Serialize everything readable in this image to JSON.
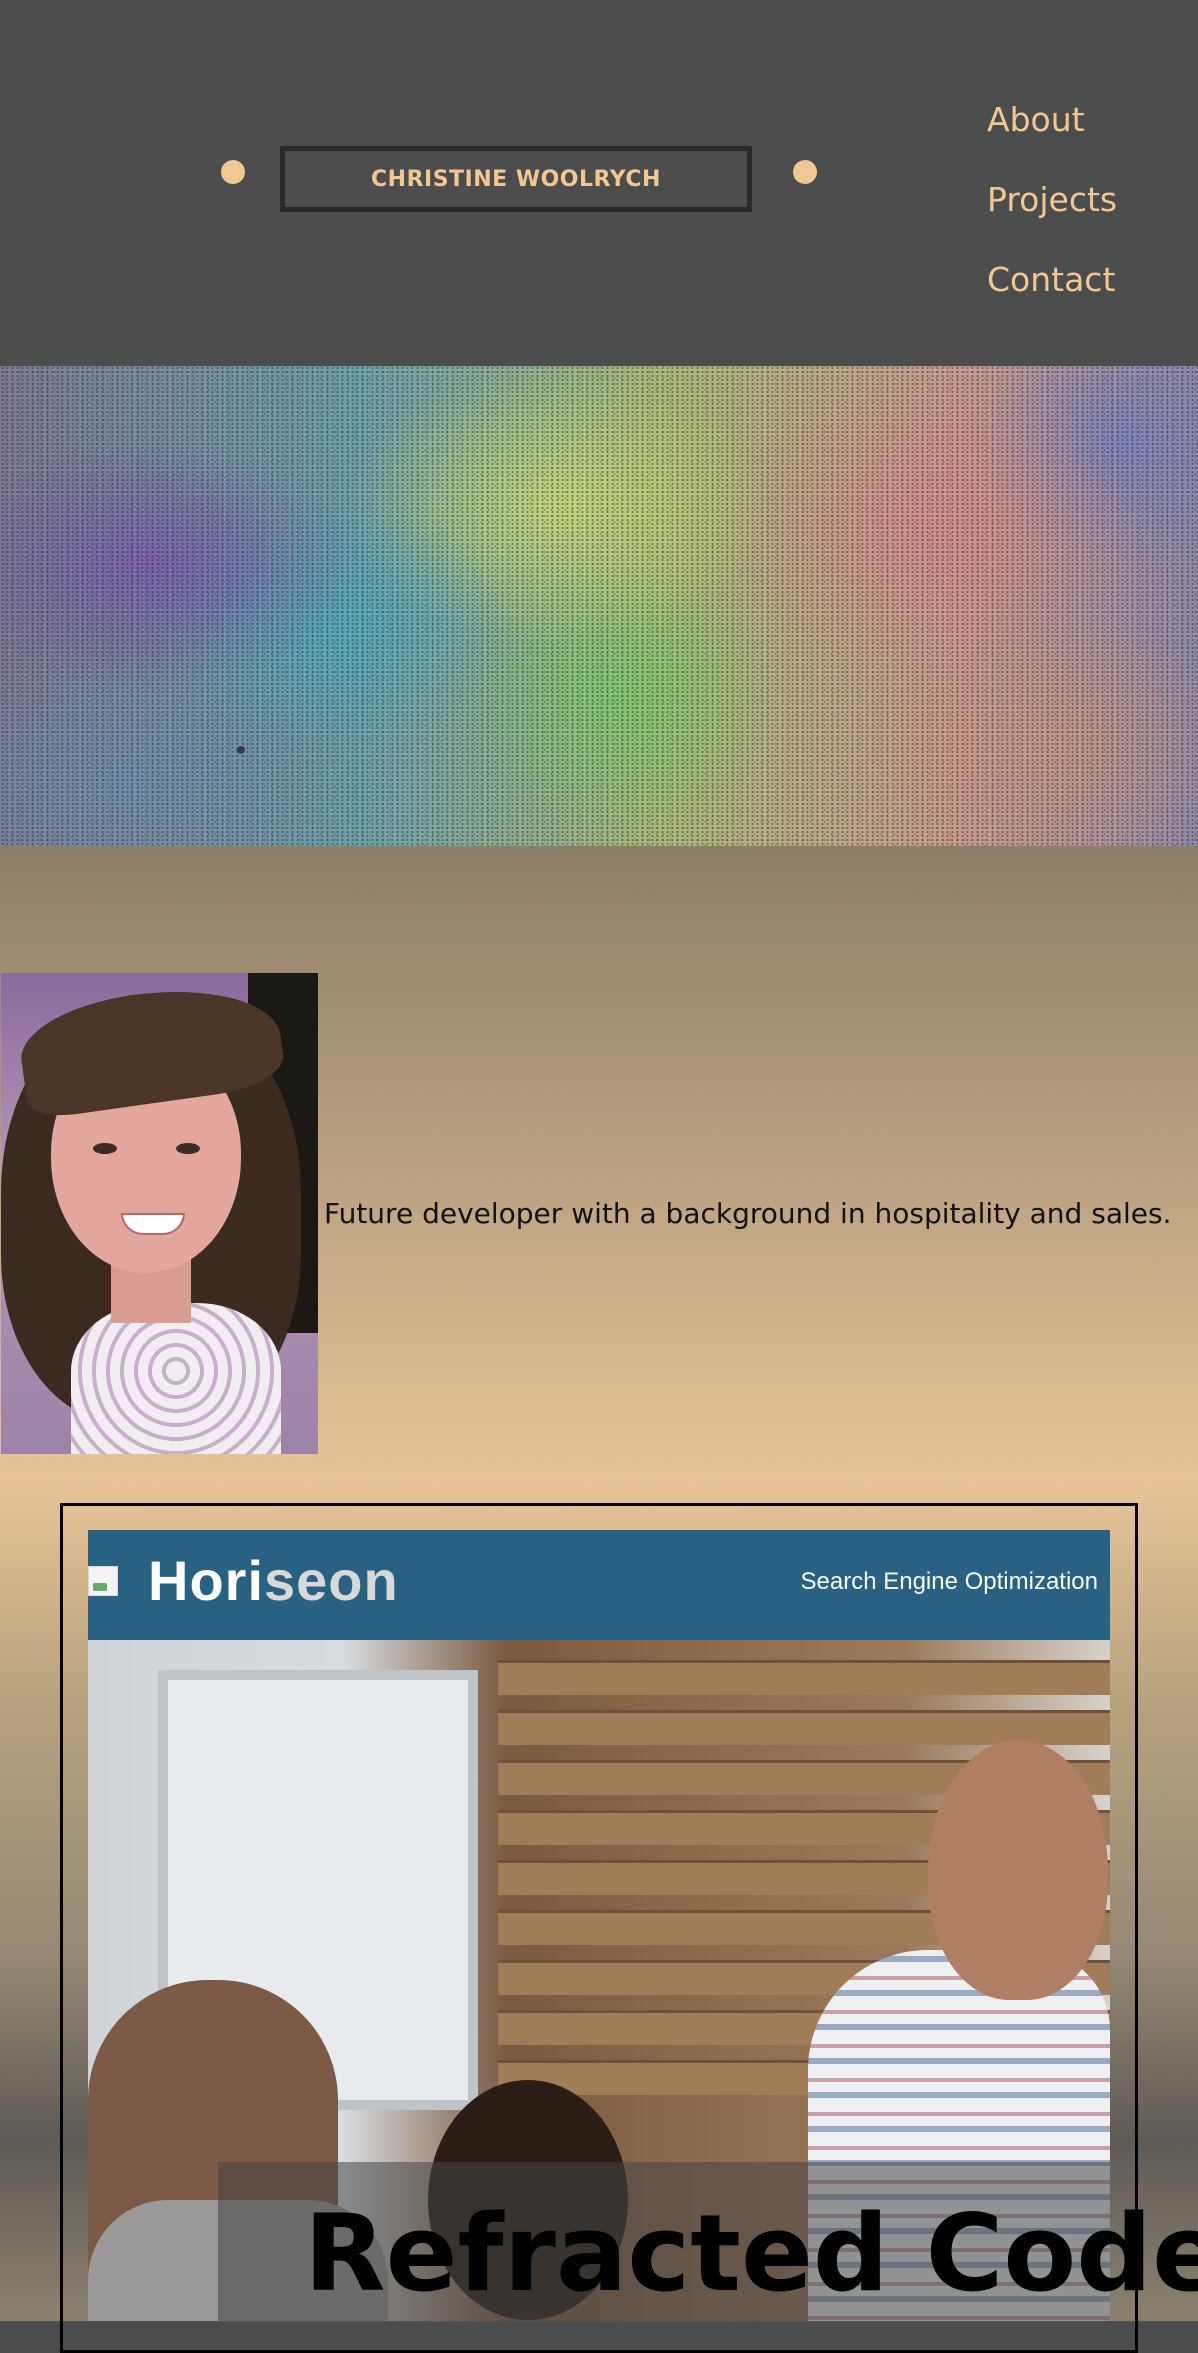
{
  "header": {
    "brand": "CHRISTINE WOOLRYCH",
    "nav": [
      "About",
      "Projects",
      "Contact"
    ]
  },
  "about": {
    "bio": "Future developer with a background in hospitality and sales."
  },
  "projects": [
    {
      "screenshot": {
        "logo_main": "Hori",
        "logo_accent": "seon",
        "tagline": "Search Engine Optimization"
      },
      "title": "Refracted Code"
    }
  ],
  "colors": {
    "header_bg": "#4b4c4c",
    "accent": "#f3c791",
    "screenshot_header": "#286181"
  }
}
